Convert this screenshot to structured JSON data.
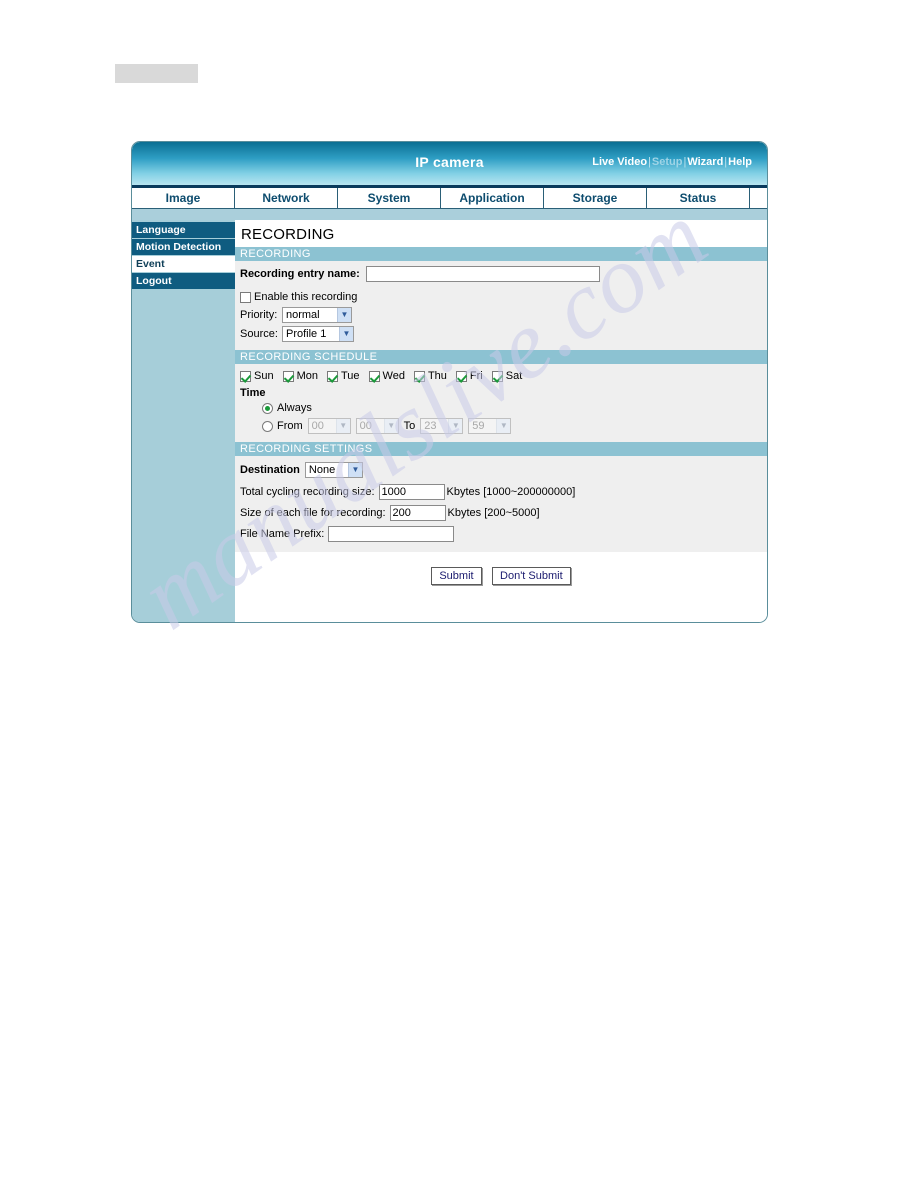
{
  "header": {
    "title": "IP camera",
    "links": [
      {
        "label": "Live Video",
        "dim": false
      },
      {
        "label": "Setup",
        "dim": true
      },
      {
        "label": "Wizard",
        "dim": false
      },
      {
        "label": "Help",
        "dim": false
      }
    ],
    "separator": "|"
  },
  "tabs": [
    {
      "label": "Image"
    },
    {
      "label": "Network"
    },
    {
      "label": "System"
    },
    {
      "label": "Application"
    },
    {
      "label": "Storage"
    },
    {
      "label": "Status"
    }
  ],
  "sidebar": {
    "items": [
      {
        "label": "Language",
        "active": false
      },
      {
        "label": "Motion Detection",
        "active": false
      },
      {
        "label": "Event",
        "active": true
      },
      {
        "label": "Logout",
        "active": false
      }
    ]
  },
  "main": {
    "page_title": "RECORDING",
    "sections": {
      "recording": {
        "bar": "RECORDING",
        "entry_name_label": "Recording entry name:",
        "entry_name_value": "",
        "entry_name_placeholder": "",
        "enable_label": "Enable this recording",
        "enable_checked": false,
        "priority_label": "Priority:",
        "priority_value": "normal",
        "source_label": "Source:",
        "source_value": "Profile 1"
      },
      "schedule": {
        "bar": "RECORDING SCHEDULE",
        "days": [
          {
            "label": "Sun",
            "checked": true
          },
          {
            "label": "Mon",
            "checked": true
          },
          {
            "label": "Tue",
            "checked": true
          },
          {
            "label": "Wed",
            "checked": true
          },
          {
            "label": "Thu",
            "checked": true
          },
          {
            "label": "Fri",
            "checked": true
          },
          {
            "label": "Sat",
            "checked": true
          }
        ],
        "time_label": "Time",
        "always_label": "Always",
        "always_selected": true,
        "from_label": "From",
        "from_selected": false,
        "from_hour": "00",
        "from_minute": "00",
        "to_label": "To",
        "to_hour": "23",
        "to_minute": "59"
      },
      "settings": {
        "bar": "RECORDING SETTINGS",
        "destination_label": "Destination",
        "destination_value": "None",
        "total_size_label": "Total cycling recording size:",
        "total_size_value": "1000",
        "total_size_unit": "Kbytes [1000~200000000]",
        "file_size_label": "Size of each file for recording:",
        "file_size_value": "200",
        "file_size_unit": "Kbytes [200~5000]",
        "prefix_label": "File Name Prefix:",
        "prefix_value": ""
      }
    },
    "buttons": {
      "submit": "Submit",
      "dont_submit": "Don't Submit"
    }
  },
  "watermark": {
    "text": "manualslive.com"
  },
  "colors": {
    "header_dark": "#0b6f93",
    "header_light": "#b8e5f0",
    "tab_text": "#0d4c6e",
    "sidebar_bg": "#a6ced9",
    "sidebar_item": "#0f5c80",
    "section_bar": "#8cc2d2",
    "section_body": "#efefef",
    "check_green": "#1a9a3a"
  }
}
